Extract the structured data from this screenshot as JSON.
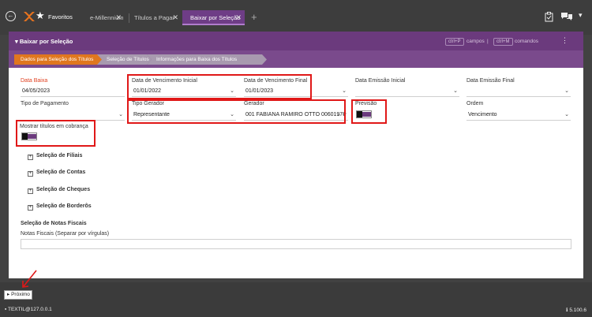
{
  "topbar": {
    "back_icon": "back-arrow-icon",
    "forward_icon": "forward-arrow-icon",
    "favorites_label": "Favoritos",
    "tabs": [
      {
        "label": "e-Millennium"
      },
      {
        "label": "Títulos a Pagar"
      },
      {
        "label": "Baixar por Seleção"
      }
    ]
  },
  "panel": {
    "title": "Baixar por Seleção",
    "shortcut1_key": "ctrl+P",
    "shortcut1_label": "campos",
    "separator": "|",
    "shortcut2_key": "ctrl+M",
    "shortcut2_label": "comandos",
    "accent_color": "#6b3a7d"
  },
  "breadcrumbs": [
    "Dados para Seleção dos Títulos",
    "Seleção de Títulos",
    "Informações para Baixa dos Títulos Selecionados"
  ],
  "fields": {
    "data_baixa": {
      "label": "Data Baixa",
      "value": "04/05/2023"
    },
    "venc_inicial": {
      "label": "Data de Vencimento Inicial",
      "value": "01/01/2022"
    },
    "venc_final": {
      "label": "Data de Vencimento Final",
      "value": "01/01/2023"
    },
    "emissao_inicial": {
      "label": "Data Emissão Inicial",
      "value": ""
    },
    "emissao_final": {
      "label": "Data Emissão Final",
      "value": ""
    },
    "tipo_pagamento": {
      "label": "Tipo de Pagamento",
      "value": ""
    },
    "tipo_gerador": {
      "label": "Tipo Gerador",
      "value": "Representante"
    },
    "gerador": {
      "label": "Gerador",
      "value": "001 FABIANA RAMIRO OTTO 00601978"
    },
    "previsao": {
      "label": "Previsão"
    },
    "ordem": {
      "label": "Ordem",
      "value": "Vencimento"
    },
    "mostrar_cobranca": {
      "label": "Mostrar títulos em cobrança"
    }
  },
  "sections": [
    "Seleção de Filiais",
    "Seleção de Contas",
    "Seleção de Cheques",
    "Seleção de Borderôs"
  ],
  "notas": {
    "title": "Seleção de Notas Fiscais",
    "label": "Notas Fiscais (Separar por vírgulas)",
    "value": ""
  },
  "footer": {
    "next_label": "Próximo",
    "status_left": "TEXTIL@127.0.0.1",
    "status_right": "5.100.6"
  }
}
